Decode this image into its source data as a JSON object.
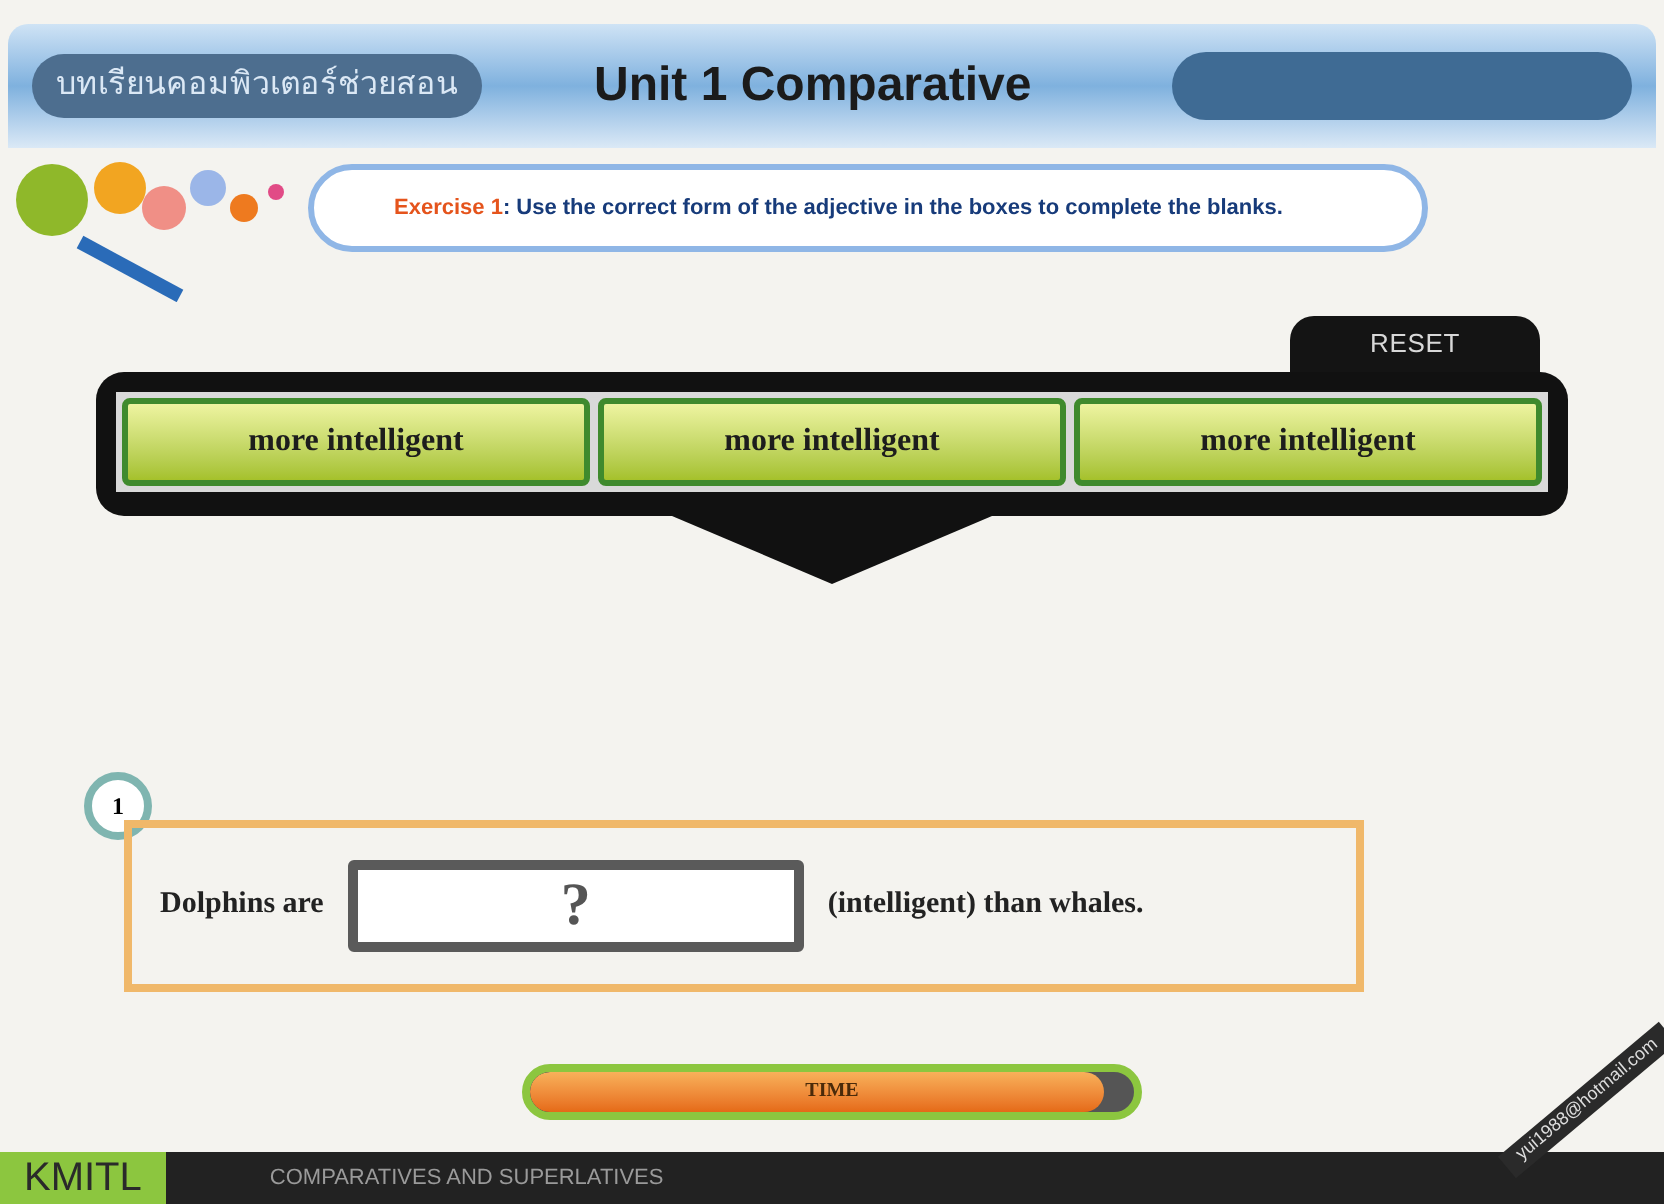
{
  "header": {
    "subtitle": "บทเรียนคอมพิวเตอร์ช่วยสอน",
    "title": "Unit 1 Comparative"
  },
  "instruction": {
    "label": "Exercise 1",
    "text": ": Use the correct form of the adjective in the boxes to complete the blanks."
  },
  "reset_button": "RESET",
  "choices": [
    "more intelligent",
    "more intelligent",
    "more intelligent"
  ],
  "question": {
    "number": "1",
    "before": "Dolphins are",
    "answer": "?",
    "after": "(intelligent)  than whales."
  },
  "timer": {
    "label": "TIME",
    "level": 0.95
  },
  "footer": {
    "logo": "KMITL",
    "caption": "COMPARATIVES  AND  SUPERLATIVES",
    "email": "yui1988@hotmail.com"
  }
}
